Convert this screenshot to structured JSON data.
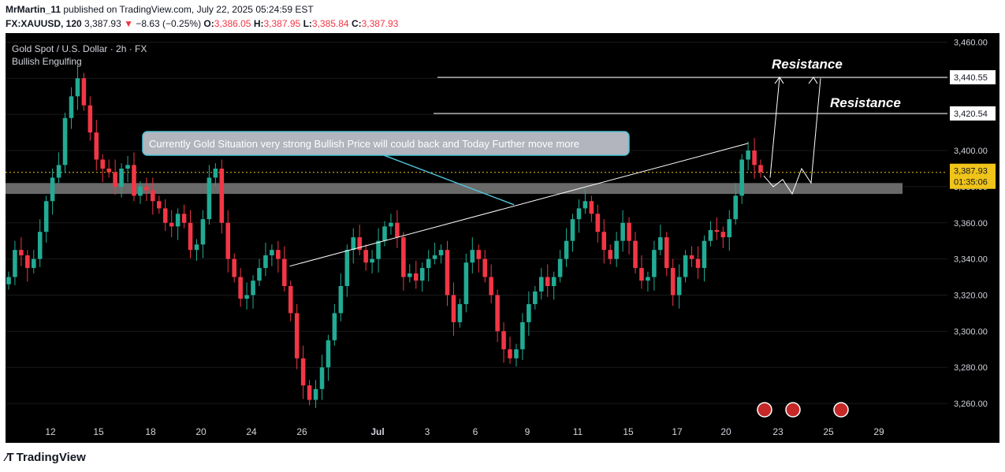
{
  "header": {
    "author": "MrMartin_11",
    "published": "published on TradingView.com, July 22, 2025 05:24:59 EST",
    "symbol": "FX:XAUUSD, 120",
    "last": "3,387.93",
    "change_arrow": "▼",
    "change": "−8.63 (−0.25%)",
    "o_label": "O:",
    "o": "3,386.05",
    "h_label": "H:",
    "h": "3,387.95",
    "l_label": "L:",
    "l": "3,385.84",
    "c_label": "C:",
    "c": "3,387.93"
  },
  "chart_data": {
    "type": "candlestick",
    "title": "Gold Spot / U.S. Dollar · 2h · FX",
    "indicator": "Bullish Engulfing",
    "ylim": [
      3250,
      3465
    ],
    "y_ticks": [
      "3,260.00",
      "3,280.00",
      "3,300.00",
      "3,320.00",
      "3,340.00",
      "3,360.00",
      "3,380.00",
      "3,400.00",
      "3,420.00",
      "3,440.00",
      "3,460.00"
    ],
    "y_tick_values": [
      3260,
      3280,
      3300,
      3320,
      3340,
      3360,
      3380,
      3400,
      3420,
      3440,
      3460
    ],
    "x_ticks": [
      "12",
      "15",
      "18",
      "20",
      "24",
      "26",
      "Jul",
      "3",
      "6",
      "9",
      "11",
      "15",
      "17",
      "20",
      "23",
      "25",
      "29"
    ],
    "x_tick_index": [
      0,
      1,
      2,
      3,
      4,
      5,
      6,
      7,
      8,
      9,
      10,
      11,
      12,
      13,
      14,
      15,
      16
    ],
    "closes": [
      3330,
      3345,
      3342,
      3335,
      3340,
      3355,
      3372,
      3385,
      3392,
      3418,
      3430,
      3440,
      3425,
      3410,
      3395,
      3390,
      3388,
      3380,
      3390,
      3392,
      3375,
      3380,
      3378,
      3372,
      3368,
      3360,
      3358,
      3365,
      3360,
      3345,
      3348,
      3362,
      3385,
      3390,
      3360,
      3340,
      3330,
      3318,
      3320,
      3328,
      3335,
      3342,
      3345,
      3340,
      3325,
      3310,
      3285,
      3270,
      3262,
      3268,
      3280,
      3295,
      3310,
      3325,
      3345,
      3352,
      3345,
      3338,
      3340,
      3350,
      3358,
      3360,
      3352,
      3330,
      3332,
      3328,
      3335,
      3340,
      3342,
      3345,
      3320,
      3305,
      3315,
      3338,
      3345,
      3340,
      3330,
      3320,
      3300,
      3290,
      3285,
      3290,
      3305,
      3315,
      3322,
      3330,
      3325,
      3330,
      3340,
      3350,
      3362,
      3368,
      3372,
      3365,
      3355,
      3345,
      3340,
      3350,
      3360,
      3350,
      3335,
      3328,
      3330,
      3345,
      3352,
      3335,
      3320,
      3330,
      3342,
      3340,
      3335,
      3350,
      3356,
      3355,
      3352,
      3362,
      3375,
      3395,
      3400,
      3392,
      3388
    ],
    "price_line": 3387.93,
    "last_price_label": "3,387.93",
    "countdown": "01:35:06",
    "zone": {
      "low": 3376,
      "high": 3382
    },
    "resistance_levels": [
      {
        "value": 3440.55,
        "label": "3,440.55"
      },
      {
        "value": 3420.54,
        "label": "3,420.54"
      }
    ],
    "resistance_text": [
      "Resistance",
      "Resistance"
    ],
    "trendline": {
      "from_index": 70,
      "from_price": 3336,
      "to_index": 118,
      "to_price": 3404
    },
    "annotation": "Currently Gold Situation very strong Bullish Price will could back and Today Further move more",
    "projection_path": [
      3386,
      3380,
      3384,
      3376,
      3390,
      3382,
      3440
    ],
    "event_icons": 3,
    "colors": {
      "up": "#22ab94",
      "down": "#f23645",
      "bg": "#000000",
      "grid": "#1a1a1a",
      "text": "#d1d4dc",
      "zone": "#7b7b7b",
      "price_line": "#f0c419",
      "note_border": "#4fc3d9"
    }
  },
  "footer": {
    "brand": "TradingView"
  }
}
